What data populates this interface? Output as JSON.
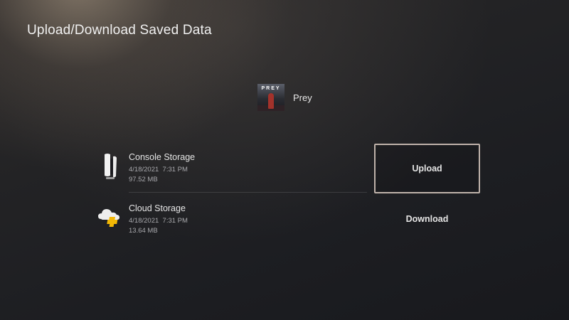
{
  "page": {
    "title": "Upload/Download Saved Data"
  },
  "game": {
    "name": "Prey",
    "thumbnail_text": "PREY"
  },
  "storages": [
    {
      "name": "Console Storage",
      "date": "4/18/2021",
      "time": "7:31 PM",
      "size": "97.52 MB",
      "icon": "ps5-console-icon"
    },
    {
      "name": "Cloud Storage",
      "date": "4/18/2021",
      "time": "7:31 PM",
      "size": "13.64 MB",
      "icon": "ps-plus-cloud-icon"
    }
  ],
  "actions": {
    "upload_label": "Upload",
    "download_label": "Download",
    "focused": "Upload"
  },
  "colors": {
    "focus_border": "#bfb2aa",
    "ps_plus_yellow": "#f2b705"
  }
}
